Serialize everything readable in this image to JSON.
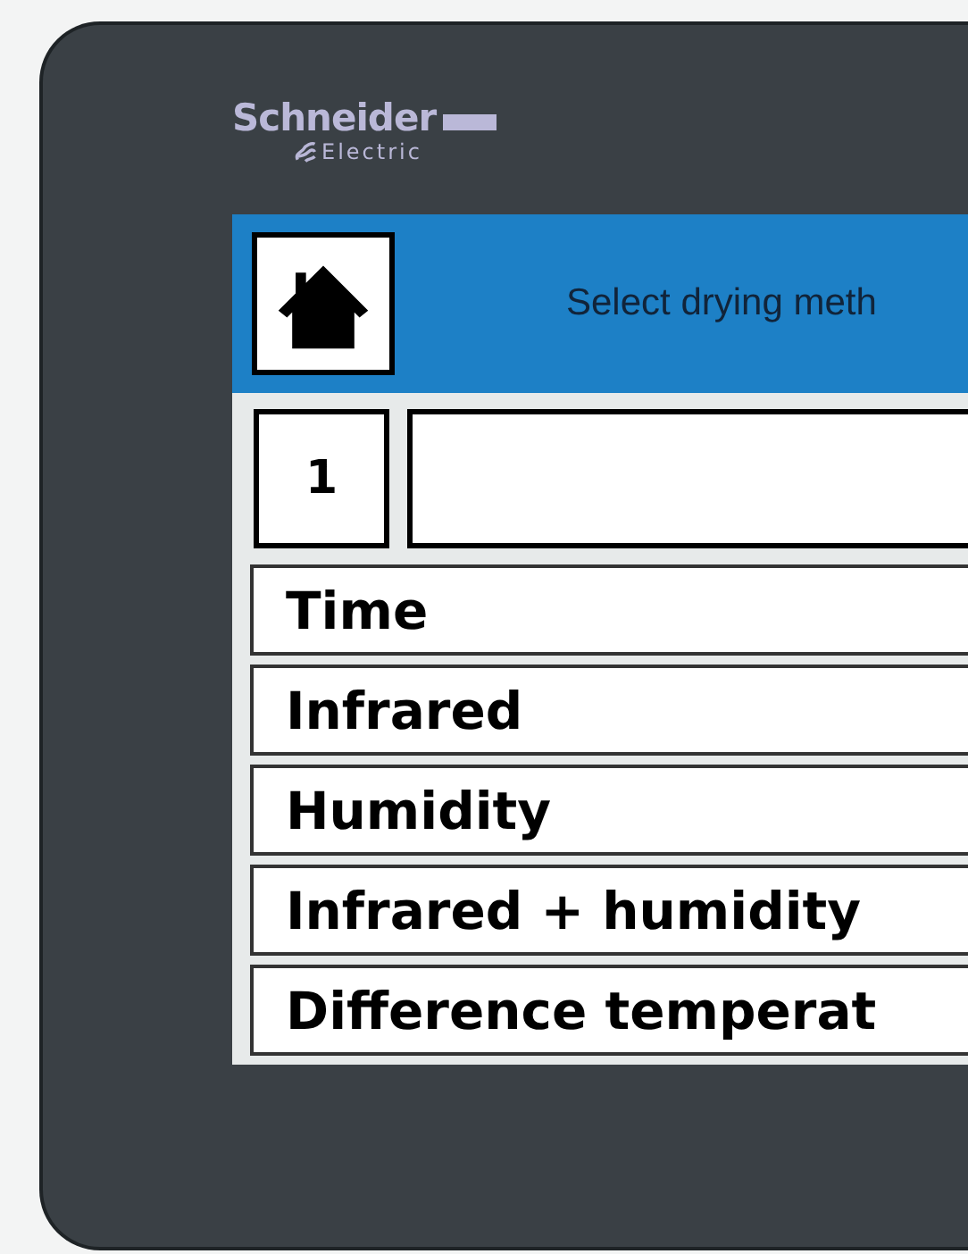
{
  "logo": {
    "brand": "Schneider",
    "sub": "Electric"
  },
  "header": {
    "title": "Select drying meth"
  },
  "entry": {
    "number": "1"
  },
  "methods": [
    {
      "label": "Time"
    },
    {
      "label": "Infrared"
    },
    {
      "label": "Humidity"
    },
    {
      "label": "Infrared + humidity"
    },
    {
      "label": "Difference temperat"
    }
  ]
}
